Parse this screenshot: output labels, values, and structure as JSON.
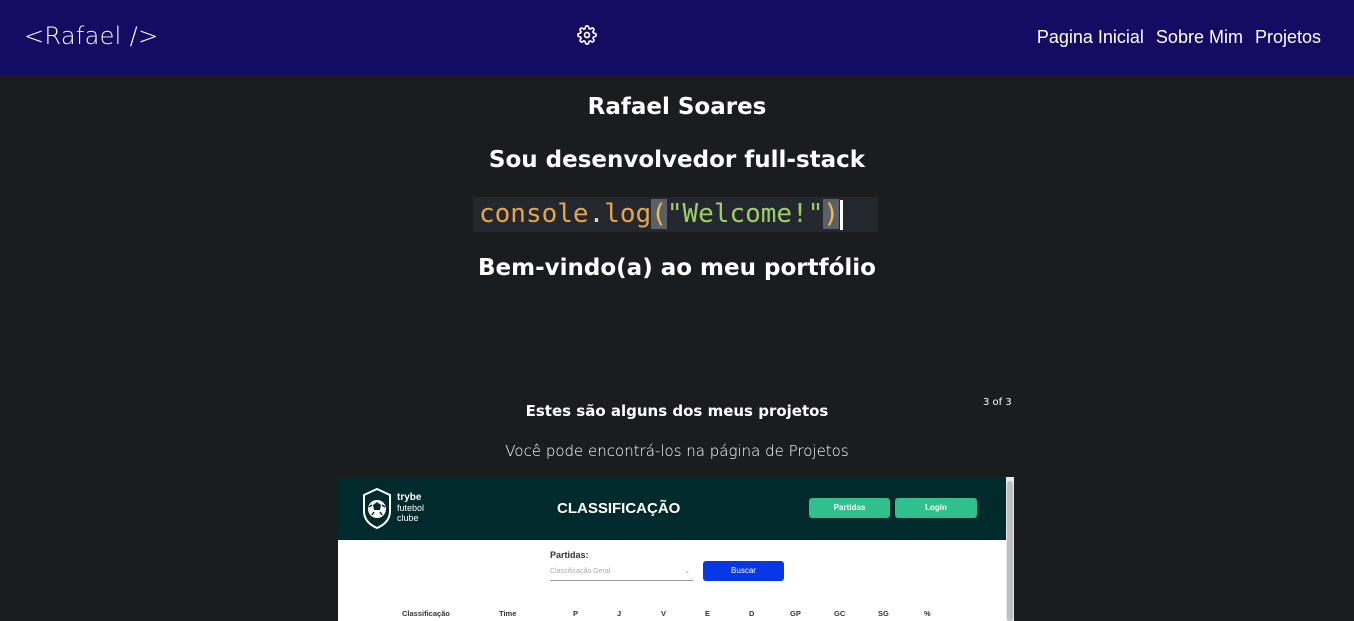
{
  "navbar": {
    "brand": "<Rafael />",
    "settings_icon": "gear-icon",
    "links": [
      "Pagina Inicial",
      "Sobre Mim",
      "Projetos"
    ],
    "background": "#140b63"
  },
  "hero": {
    "name": "Rafael Soares",
    "role": "Sou desenvolvedor full-stack",
    "code": {
      "object": "console",
      "dot": ".",
      "method": "log",
      "open_paren": "(",
      "string": "\"Welcome!\"",
      "close_paren": ")"
    },
    "welcome": "Bem-vindo(a) ao meu portfólio"
  },
  "projects": {
    "title": "Estes são alguns dos meus projetos",
    "counter": "3 of 3",
    "subtitle": "Você pode encontrá-los na página de Projetos",
    "preview": {
      "logo_line1": "trybe",
      "logo_line2": "futebol",
      "logo_line3": "clube",
      "heading": "CLASSIFICAÇÃO",
      "buttons": [
        "Partidas",
        "Login"
      ],
      "filter_label": "Partidas:",
      "filter_value": "Classificação Geral",
      "search_button": "Buscar",
      "columns": [
        "Classificação",
        "Time",
        "P",
        "J",
        "V",
        "E",
        "D",
        "GP",
        "GC",
        "SG",
        "%"
      ],
      "accent": "#2fc08d",
      "header_color": "#002a2c",
      "search_color": "#0737e6"
    }
  }
}
